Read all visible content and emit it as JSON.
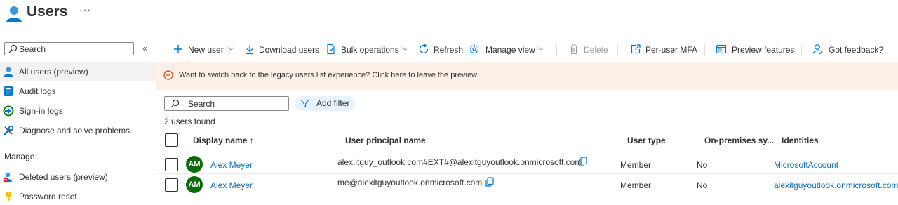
{
  "header": {
    "title": "Users",
    "more": "···"
  },
  "sidebar": {
    "search_placeholder": "Search",
    "collapse": "«",
    "items": [
      {
        "label": "All users (preview)",
        "icon": "users-icon",
        "active": true
      },
      {
        "label": "Audit logs",
        "icon": "audit-log-icon"
      },
      {
        "label": "Sign-in logs",
        "icon": "sign-in-icon"
      },
      {
        "label": "Diagnose and solve problems",
        "icon": "wrench-icon"
      }
    ],
    "section_manage": "Manage",
    "manage_items": [
      {
        "label": "Deleted users (preview)",
        "icon": "deleted-user-icon"
      },
      {
        "label": "Password reset",
        "icon": "key-icon"
      }
    ]
  },
  "toolbar": {
    "new_user": "New user",
    "download_users": "Download users",
    "bulk_operations": "Bulk operations",
    "refresh": "Refresh",
    "manage_view": "Manage view",
    "delete": "Delete",
    "per_user_mfa": "Per-user MFA",
    "preview_features": "Preview features",
    "got_feedback": "Got feedback?"
  },
  "banner": {
    "text": "Want to switch back to the legacy users list experience? Click here to leave the preview."
  },
  "list": {
    "search_placeholder": "Search",
    "add_filter": "Add filter",
    "count": "2 users found"
  },
  "table": {
    "headers": {
      "display_name": "Display name ↑",
      "upn": "User principal name",
      "user_type": "User type",
      "on_prem": "On-premises sy...",
      "identities": "Identities"
    },
    "rows": [
      {
        "initials": "AM",
        "display_name": "Alex Meyer",
        "upn": "alex.itguy_outlook.com#EXT#@alexitguyoutlook.onmicrosoft.com",
        "user_type": "Member",
        "on_prem": "No",
        "identities": "MicrosoftAccount"
      },
      {
        "initials": "AM",
        "display_name": "Alex Meyer",
        "upn": "me@alexitguyoutlook.onmicrosoft.com",
        "user_type": "Member",
        "on_prem": "No",
        "identities": "alexitguyoutlook.onmicrosoft.com"
      }
    ]
  },
  "colors": {
    "accent": "#0f6cbd",
    "avatar": "#0b6a0b",
    "banner": "#fdf0e8",
    "warning": "#d83b01"
  }
}
